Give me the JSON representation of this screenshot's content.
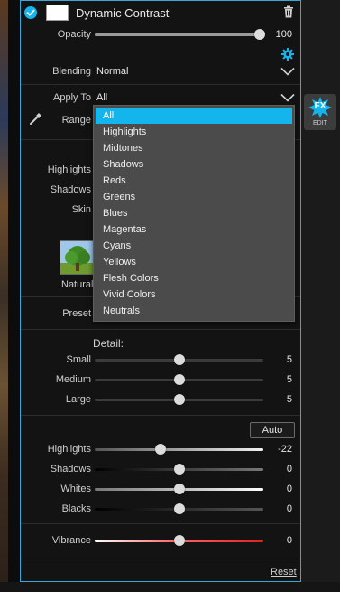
{
  "layer": {
    "title": "Dynamic Contrast",
    "enabled": true,
    "opacity_label": "Opacity",
    "opacity_value": "100",
    "opacity": 1.0,
    "blending_label": "Blending",
    "blending_value": "Normal"
  },
  "apply_to": {
    "label": "Apply To",
    "value": "All",
    "range_label": "Range",
    "options": [
      "All",
      "Highlights",
      "Midtones",
      "Shadows",
      "Reds",
      "Greens",
      "Blues",
      "Magentas",
      "Cyans",
      "Yellows",
      "Flesh Colors",
      "Vivid Colors",
      "Neutrals"
    ],
    "selected_index": 0
  },
  "partial_labels": {
    "highlights": "Highlights",
    "shadows": "Shadows",
    "skin": "Skin",
    "preset_thumb": "Natural",
    "preset": "Preset"
  },
  "fx_button": {
    "label": "EDIT",
    "badge": "FX"
  },
  "detail": {
    "title": "Detail:",
    "sliders": [
      {
        "name": "Small",
        "value": "5",
        "pos": 0.5
      },
      {
        "name": "Medium",
        "value": "5",
        "pos": 0.5
      },
      {
        "name": "Large",
        "value": "5",
        "pos": 0.5
      }
    ]
  },
  "tone": {
    "auto_label": "Auto",
    "sliders": [
      {
        "name": "Highlights",
        "value": "-22",
        "pos": 0.39
      },
      {
        "name": "Shadows",
        "value": "0",
        "pos": 0.5
      },
      {
        "name": "Whites",
        "value": "0",
        "pos": 0.5
      },
      {
        "name": "Blacks",
        "value": "0",
        "pos": 0.5
      }
    ]
  },
  "vibrance": {
    "name": "Vibrance",
    "value": "0",
    "pos": 0.5
  },
  "footer": {
    "reset_label": "Reset"
  },
  "colors": {
    "accent": "#13b5ec",
    "border": "#36a9d8",
    "panel": "#131313",
    "vibrance": "#e02020"
  }
}
